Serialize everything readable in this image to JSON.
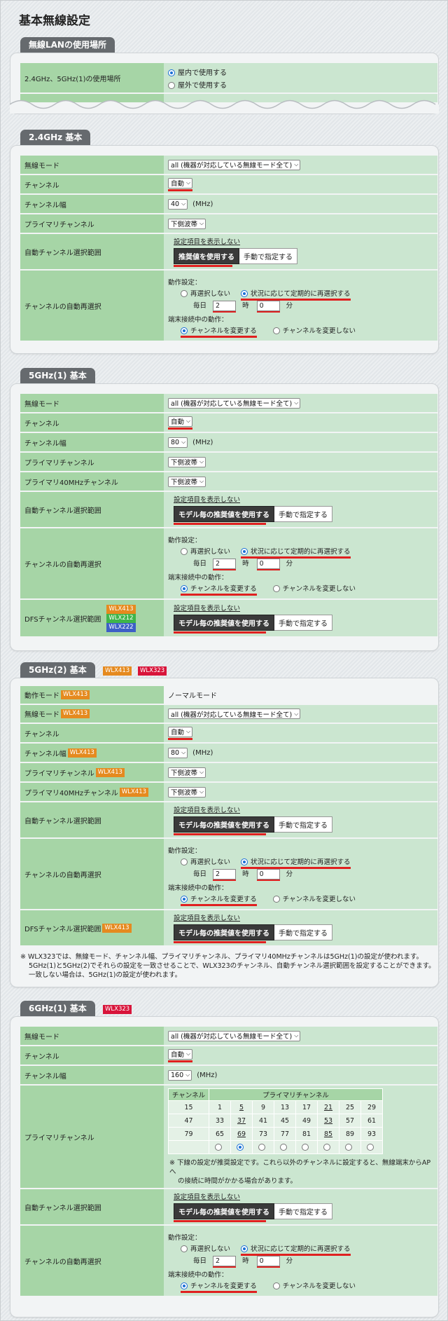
{
  "page_title": "基本無線設定",
  "usage": {
    "tab": "無線LANの使用場所",
    "label": "2.4GHz、5GHz(1)の使用場所",
    "opt_indoor": "屋内で使用する",
    "opt_outdoor": "屋外で使用する"
  },
  "common": {
    "mode_value": "all (機器が対応している無線モード全て)",
    "auto": "自動",
    "mhz": "(MHz)",
    "lower": "下側波帯",
    "hide_settings": "設定項目を表示しない",
    "recommended": "推奨値を使用する",
    "model_recommended": "モデル毎の推奨値を使用する",
    "manual": "手動で指定する",
    "op_setting": "動作設定：",
    "no_reselect": "再選択しない",
    "periodic": "状況に応じて定期的に再選択する",
    "daily": "毎日",
    "hour_unit": "時",
    "min_unit": "分",
    "hour_val": "2",
    "min_val": "0",
    "client_action": "端末接続中の動作：",
    "change_ch": "チャンネルを変更する",
    "no_change_ch": "チャンネルを変更しない"
  },
  "labels": {
    "wireless_mode": "無線モード",
    "channel": "チャンネル",
    "channel_width": "チャンネル幅",
    "primary_channel": "プライマリチャンネル",
    "primary40": "プライマリ40MHzチャンネル",
    "auto_range": "自動チャンネル選択範囲",
    "auto_reselect": "チャンネルの自動再選択",
    "dfs_range": "DFSチャンネル選択範囲",
    "op_mode": "動作モード"
  },
  "sec24": {
    "tab": "2.4GHz 基本",
    "width": "40"
  },
  "sec5a": {
    "tab": "5GHz(1) 基本",
    "width": "80",
    "dfs_badges": [
      "WLX413",
      "WLX212",
      "WLX222"
    ]
  },
  "sec5b": {
    "tab": "5GHz(2) 基本",
    "tab_badges": [
      "WLX413",
      "WLX323"
    ],
    "badge": "WLX413",
    "op_mode_value": "ノーマルモード",
    "width": "80",
    "note": [
      "※ WLX323では、無線モード、チャンネル幅、プライマリチャンネル、プライマリ40MHzチャンネルは5GHz(1)の設定が使われます。",
      "5GHz(1)と5GHz(2)でそれらの設定を一致させることで、WLX323のチャンネル、自動チャンネル選択範囲を設定することができます。",
      "一致しない場合は、5GHz(1)の設定が使われます。"
    ]
  },
  "sec6": {
    "tab": "6GHz(1) 基本",
    "tab_badge": "WLX323",
    "width": "160",
    "grid_head_ch": "チャンネル",
    "grid_head_primary": "プライマリチャンネル",
    "grid": [
      [
        "15",
        "1",
        "5",
        "9",
        "13",
        "17",
        "21",
        "25",
        "29"
      ],
      [
        "47",
        "33",
        "37",
        "41",
        "45",
        "49",
        "53",
        "57",
        "61"
      ],
      [
        "79",
        "65",
        "69",
        "73",
        "77",
        "81",
        "85",
        "89",
        "93"
      ]
    ],
    "grid_note": [
      "※ 下線の設定が推奨設定です。これら以外のチャンネルに設定すると、無線端末からAPへ",
      "の接続に時間がかかる場合があります。"
    ]
  }
}
